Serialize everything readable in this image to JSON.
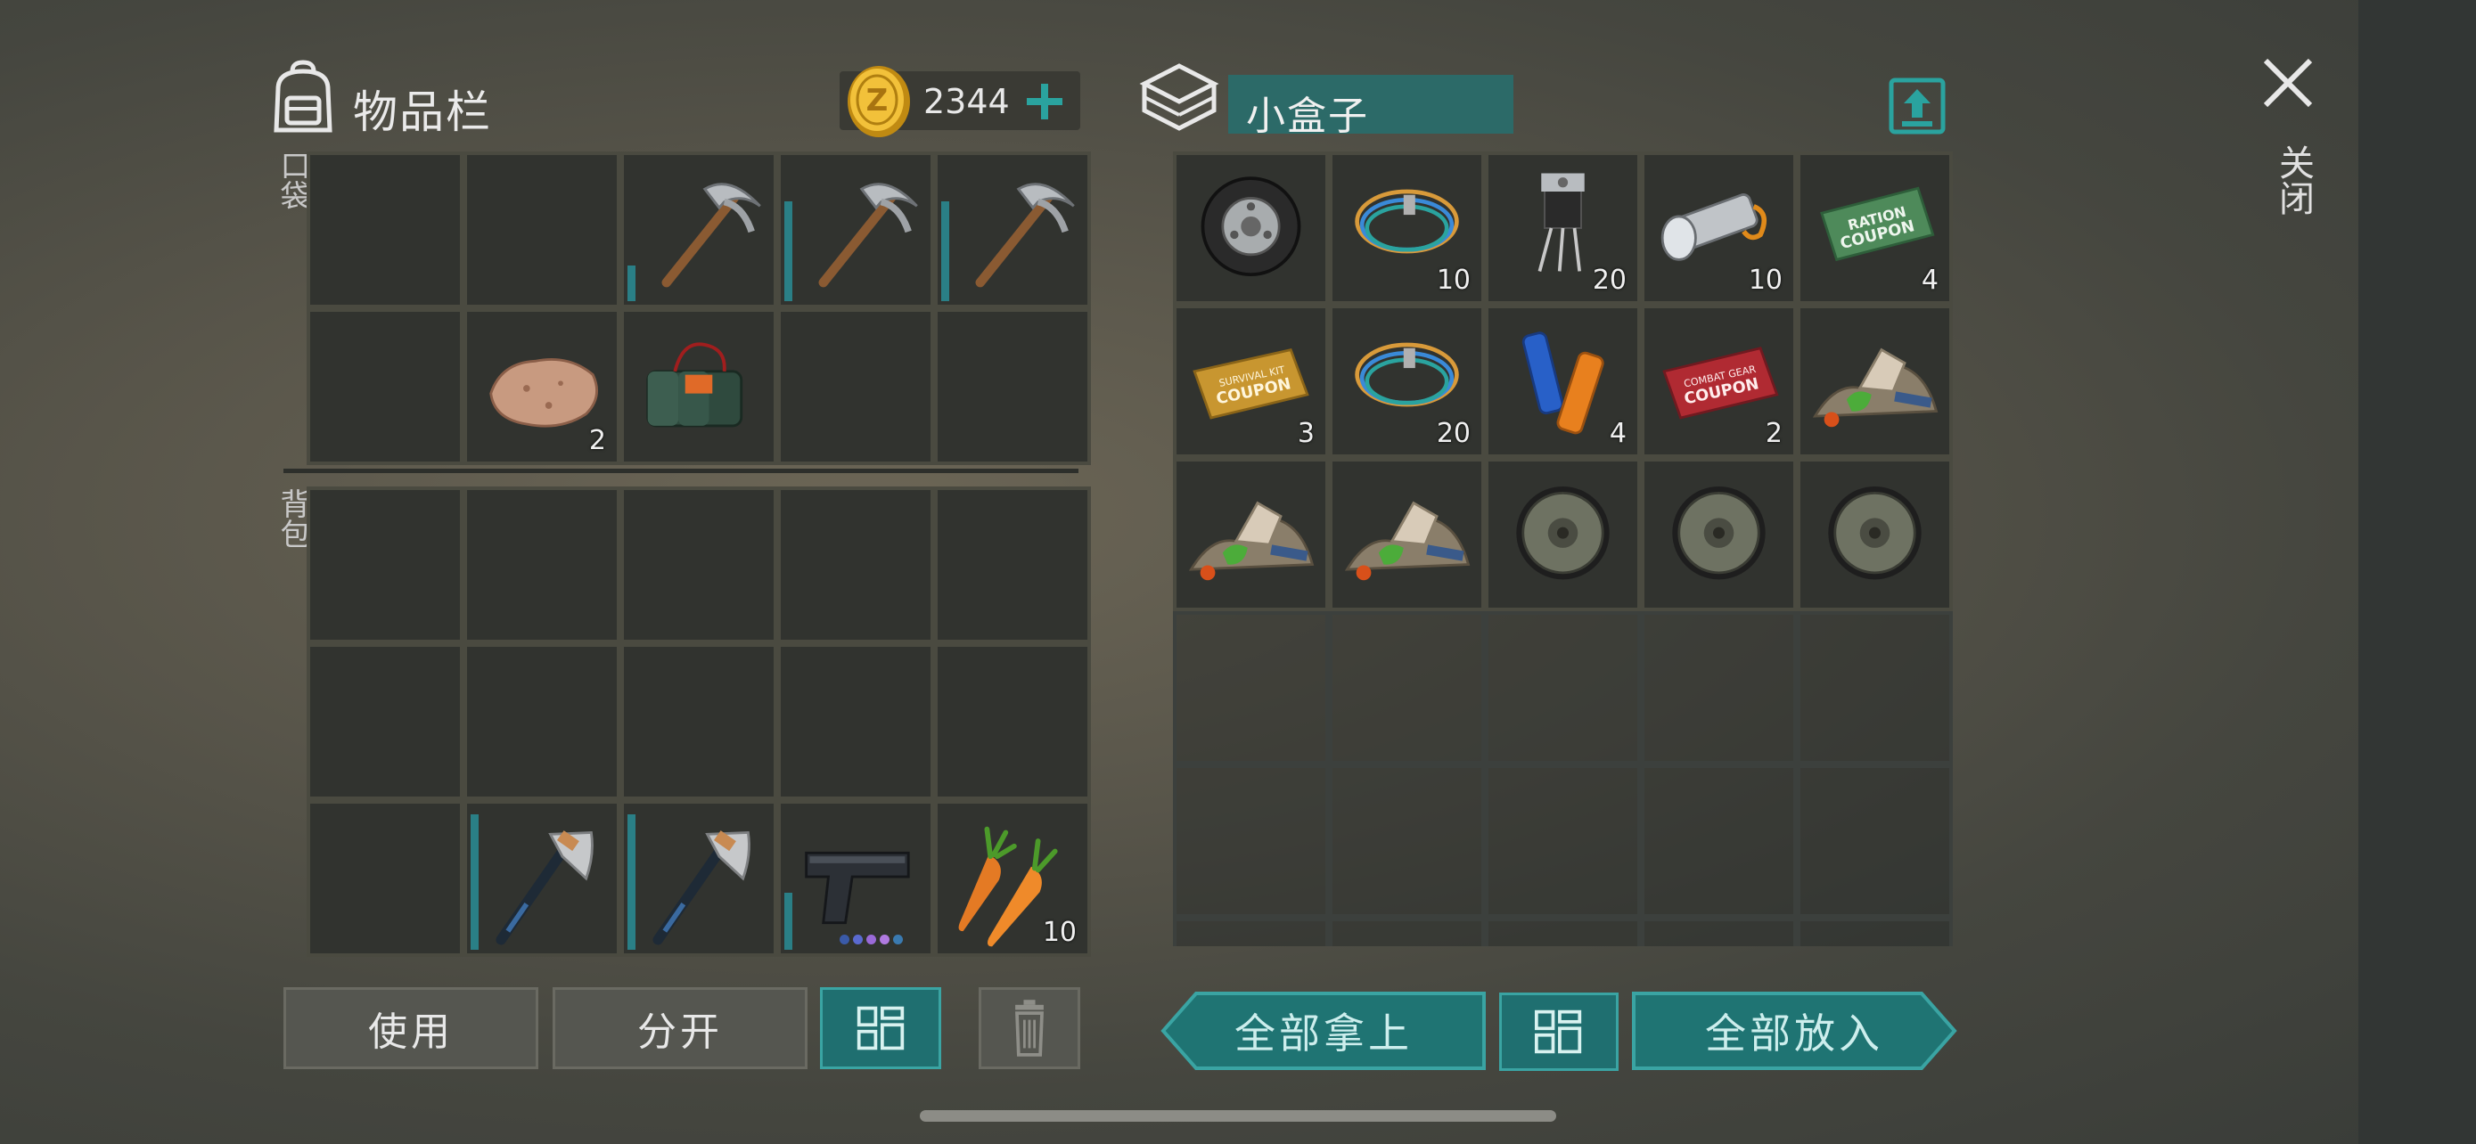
{
  "inventory": {
    "title": "物品栏",
    "coins": "2344",
    "pocket_label": "口袋",
    "bag_label": "背包",
    "pocket_slots": [
      {
        "item": "",
        "qty": ""
      },
      {
        "item": "",
        "qty": ""
      },
      {
        "item": "pickaxe-icon",
        "qty": "",
        "durability": 0.25
      },
      {
        "item": "pickaxe-icon",
        "qty": "",
        "durability": 0.7
      },
      {
        "item": "pickaxe-icon",
        "qty": "",
        "durability": 0.7
      },
      {
        "item": "",
        "qty": ""
      },
      {
        "item": "stone-icon",
        "qty": "2"
      },
      {
        "item": "explosive-charge-icon",
        "qty": ""
      },
      {
        "item": "",
        "qty": ""
      },
      {
        "item": "",
        "qty": ""
      }
    ],
    "bag_slots": [
      {
        "item": "",
        "qty": ""
      },
      {
        "item": "",
        "qty": ""
      },
      {
        "item": "",
        "qty": ""
      },
      {
        "item": "",
        "qty": ""
      },
      {
        "item": "",
        "qty": ""
      },
      {
        "item": "",
        "qty": ""
      },
      {
        "item": "",
        "qty": ""
      },
      {
        "item": "",
        "qty": ""
      },
      {
        "item": "",
        "qty": ""
      },
      {
        "item": "",
        "qty": ""
      },
      {
        "item": "",
        "qty": ""
      },
      {
        "item": "axe-icon",
        "qty": "",
        "durability": 0.95
      },
      {
        "item": "axe-icon",
        "qty": "",
        "durability": 0.95
      },
      {
        "item": "pistol-icon",
        "qty": "",
        "durability": 0.4
      },
      {
        "item": "carrot-icon",
        "qty": "10"
      }
    ],
    "buttons": {
      "use": "使用",
      "split": "分开"
    }
  },
  "container": {
    "name": "小盒子",
    "slots": [
      {
        "item": "tire-icon",
        "qty": ""
      },
      {
        "item": "wires-icon",
        "qty": "10"
      },
      {
        "item": "transistor-icon",
        "qty": "20"
      },
      {
        "item": "flashlight-icon",
        "qty": "10"
      },
      {
        "item": "ration-coupon-icon",
        "qty": "4",
        "text": "RATION COUPON"
      },
      {
        "item": "survival-kit-coupon-icon",
        "qty": "3",
        "text": "SURVIVAL KIT COUPON"
      },
      {
        "item": "wires-icon",
        "qty": "20"
      },
      {
        "item": "batteries-icon",
        "qty": "4"
      },
      {
        "item": "combat-gear-coupon-icon",
        "qty": "2",
        "text": "COMBAT GEAR COUPON"
      },
      {
        "item": "scrap-pile-icon",
        "qty": ""
      },
      {
        "item": "scrap-pile-icon",
        "qty": ""
      },
      {
        "item": "scrap-pile-icon",
        "qty": ""
      },
      {
        "item": "wheel-icon",
        "qty": ""
      },
      {
        "item": "wheel-icon",
        "qty": ""
      },
      {
        "item": "wheel-icon",
        "qty": ""
      }
    ],
    "empty_slot_count": 10,
    "buttons": {
      "take_all": "全部拿上",
      "put_all": "全部放入"
    }
  },
  "close_label": "关闭",
  "colors": {
    "accent": "#2c6a68",
    "durability": "#2a7f86",
    "button_grey": "#555650"
  }
}
